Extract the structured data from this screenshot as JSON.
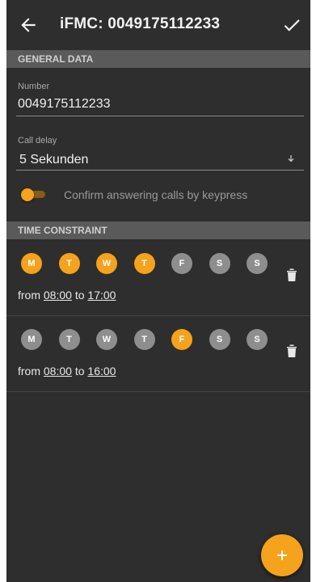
{
  "appbar": {
    "title": "iFMC: 0049175112233",
    "back_icon": "arrow-left-icon",
    "save_icon": "check-icon"
  },
  "general": {
    "section_title": "GENERAL DATA",
    "number_label": "Number",
    "number_value": "0049175112233",
    "call_delay_label": "Call delay",
    "call_delay_value": "5 Sekunden",
    "confirm_toggle": {
      "label": "Confirm answering calls by keypress",
      "on": true
    }
  },
  "time_constraint": {
    "section_title": "TIME CONSTRAINT",
    "rows": [
      {
        "days": [
          {
            "letter": "M",
            "active": true
          },
          {
            "letter": "T",
            "active": true
          },
          {
            "letter": "W",
            "active": true
          },
          {
            "letter": "T",
            "active": true
          },
          {
            "letter": "F",
            "active": false
          },
          {
            "letter": "S",
            "active": false
          },
          {
            "letter": "S",
            "active": false
          }
        ],
        "from_word": "from",
        "from_time": "08:00",
        "to_word": "to",
        "to_time": "17:00"
      },
      {
        "days": [
          {
            "letter": "M",
            "active": false
          },
          {
            "letter": "T",
            "active": false
          },
          {
            "letter": "W",
            "active": false
          },
          {
            "letter": "T",
            "active": false
          },
          {
            "letter": "F",
            "active": true
          },
          {
            "letter": "S",
            "active": false
          },
          {
            "letter": "S",
            "active": false
          }
        ],
        "from_word": "from",
        "from_time": "08:00",
        "to_word": "to",
        "to_time": "16:00"
      }
    ]
  },
  "fab_icon": "plus-icon",
  "colors": {
    "accent": "#f5a21c",
    "inactive_day": "#8e8e8e",
    "background": "#2e2e2e",
    "section_header": "#5a5a5a"
  }
}
